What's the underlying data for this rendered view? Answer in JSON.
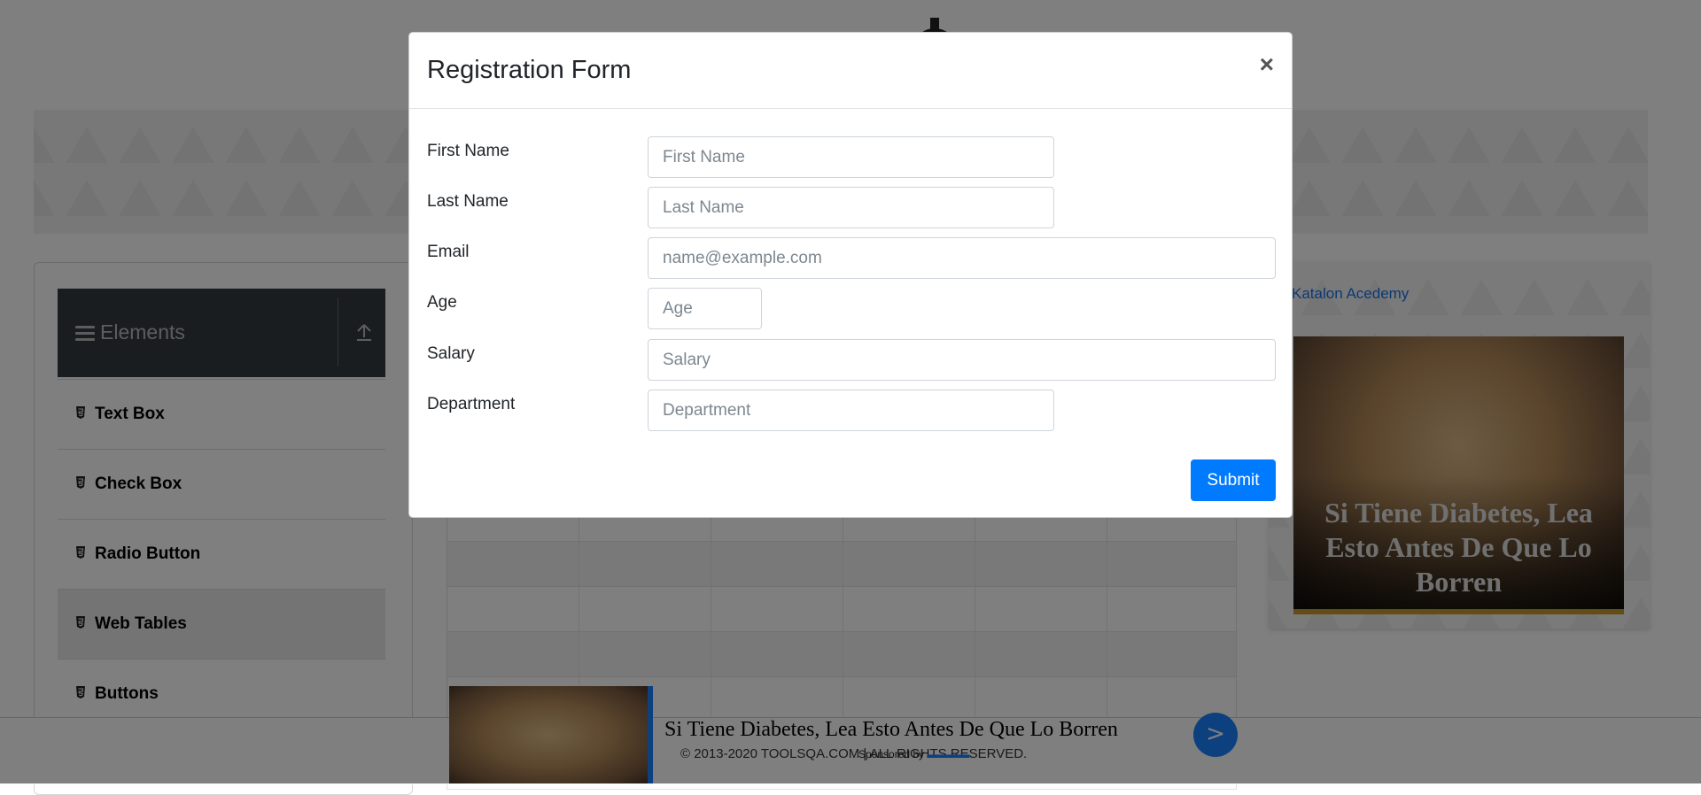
{
  "sidebar": {
    "group_title": "Elements",
    "items": [
      {
        "label": "Text Box"
      },
      {
        "label": "Check Box"
      },
      {
        "label": "Radio Button"
      },
      {
        "label": "Web Tables"
      },
      {
        "label": "Buttons"
      }
    ],
    "active_item": "Web Tables"
  },
  "right_ad": {
    "broken_image_alt": "Katalon Acedemy",
    "headline": "Si Tiene Diabetes, Lea Esto Antes De Que Lo Borren"
  },
  "bottom_ad": {
    "headline": "Si Tiene Diabetes, Lea Esto Antes De Que Lo Borren",
    "sponsored_prefix": "Sponsored by",
    "go_label": ">"
  },
  "footer": {
    "copyright": "© 2013-2020 TOOLSQA.COM | ALL RIGHTS RESERVED."
  },
  "modal": {
    "title": "Registration Form",
    "close_label": "×",
    "fields": {
      "first_name": {
        "label": "First Name",
        "placeholder": "First Name",
        "value": ""
      },
      "last_name": {
        "label": "Last Name",
        "placeholder": "Last Name",
        "value": ""
      },
      "email": {
        "label": "Email",
        "placeholder": "name@example.com",
        "value": ""
      },
      "age": {
        "label": "Age",
        "placeholder": "Age",
        "value": ""
      },
      "salary": {
        "label": "Salary",
        "placeholder": "Salary",
        "value": ""
      },
      "department": {
        "label": "Department",
        "placeholder": "Department",
        "value": ""
      }
    },
    "submit_label": "Submit"
  },
  "colors": {
    "primary": "#007bff",
    "sidebar_header": "#343a40",
    "backdrop": "#000000"
  }
}
